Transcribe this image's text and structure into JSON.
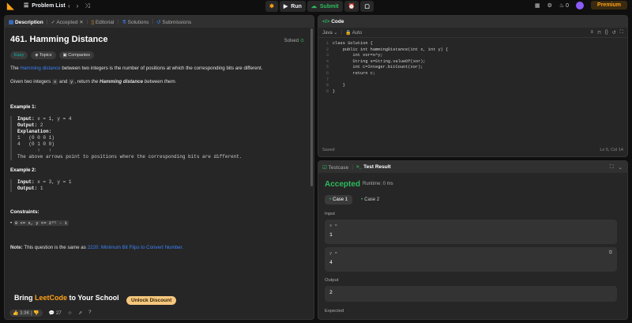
{
  "topbar": {
    "problem_list": "Problem List",
    "run": "Run",
    "submit": "Submit",
    "streak": "0",
    "premium": "Premium"
  },
  "left": {
    "tabs": {
      "description": "Description",
      "accepted": "Accepted",
      "editorial": "Editorial",
      "solutions": "Solutions",
      "submissions": "Submissions"
    },
    "title": "461. Hamming Distance",
    "status": "Solved",
    "chips": {
      "difficulty": "Easy",
      "topics": "Topics",
      "companies": "Companies"
    },
    "p1_pre": "The ",
    "p1_link": "Hamming distance",
    "p1_post": " between two integers is the number of positions at which the corresponding bits are different.",
    "p2_a": "Given two integers ",
    "p2_x": "x",
    "p2_b": " and ",
    "p2_y": "y",
    "p2_c": ", return ",
    "p2_d": "the ",
    "p2_e": "Hamming distance",
    "p2_f": " between them.",
    "ex1_title": "Example 1:",
    "ex1_input_label": "Input:",
    "ex1_input": " x = 1, y = 4",
    "ex1_output_label": "Output:",
    "ex1_output": " 2",
    "ex1_expl_label": "Explanation:",
    "ex1_line1": "1   (0 0 0 1)",
    "ex1_line2": "4   (0 1 0 0)",
    "ex1_line3": "       ↑   ↑",
    "ex1_line4": "The above arrows point to positions where the corresponding bits are different.",
    "ex2_title": "Example 2:",
    "ex2_input_label": "Input:",
    "ex2_input": " x = 3, y = 1",
    "ex2_output_label": "Output:",
    "ex2_output": " 1",
    "constraints_title": "Constraints:",
    "constraint": "0 <= x, y <= 2³¹ - 1",
    "note_label": "Note:",
    "note_text": " This question is the same as ",
    "note_link": "2220: Minimum Bit Flips to Convert Number.",
    "bring_a": "Bring ",
    "bring_b": "LeetCode",
    "bring_c": " to Your School",
    "unlock": "Unlock Discount",
    "likes": "3.9K",
    "comments": "27"
  },
  "code": {
    "tab": "Code",
    "lang": "Java",
    "auto": "Auto",
    "lines": [
      "class Solution {",
      "    public int hammingDistance(int x, int y) {",
      "        int xor=x^y;",
      "        String s=String.valueOf(xor);",
      "        int c=Integer.bitCount(xor);",
      "        return c;",
      "",
      "    }",
      "}"
    ],
    "line_numbers": [
      "1",
      "2",
      "3",
      "4",
      "5",
      "6",
      "7",
      "8",
      "9"
    ],
    "saved": "Saved",
    "cursor": "Ln 5, Col 14"
  },
  "result": {
    "testcase_tab": "Testcase",
    "result_tab": "Test Result",
    "verdict": "Accepted",
    "runtime": "Runtime: 0 ms",
    "case1": "Case 1",
    "case2": "Case 2",
    "input_label": "Input",
    "x_label": "x =",
    "x_val": "1",
    "y_label": "y =",
    "y_val": "4",
    "output_label": "Output",
    "output_val": "2",
    "expected_label": "Expected"
  }
}
